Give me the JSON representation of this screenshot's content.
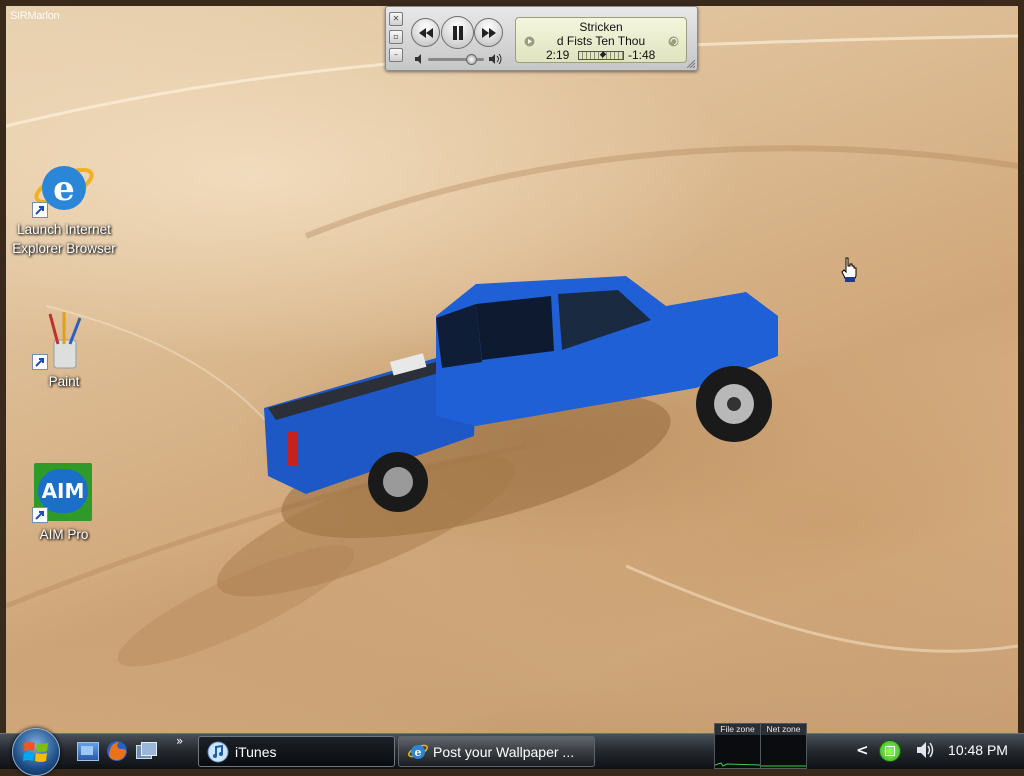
{
  "watermark": "SIRMarlon",
  "desktop_icons": [
    {
      "name": "internet-explorer",
      "label_line1": "Launch Internet",
      "label_line2": "Explorer Browser"
    },
    {
      "name": "paint",
      "label_line1": "Paint"
    },
    {
      "name": "aim-pro",
      "label_line1": "AIM Pro",
      "logo_text": "AIM"
    }
  ],
  "itunes": {
    "line1": "Stricken",
    "line2": "d Fists   Ten Thou",
    "elapsed": "2:19",
    "remaining": "-1:48",
    "progress": 0.55,
    "volume": 0.8
  },
  "taskbar": {
    "tasks": [
      {
        "label": "iTunes",
        "icon": "itunes-icon",
        "active": true
      },
      {
        "label": "Post your Wallpaper ...",
        "icon": "internet-explorer-icon",
        "active": false
      }
    ],
    "overflow": "»",
    "meters": [
      {
        "label": "File zone"
      },
      {
        "label": "Net zone"
      }
    ],
    "tray_chevron": "<",
    "clock": "10:48 PM"
  },
  "colors": {
    "taskbar": "#1a1e23",
    "truck_blue": "#1f5fd1",
    "sand": "#d9b68c"
  }
}
